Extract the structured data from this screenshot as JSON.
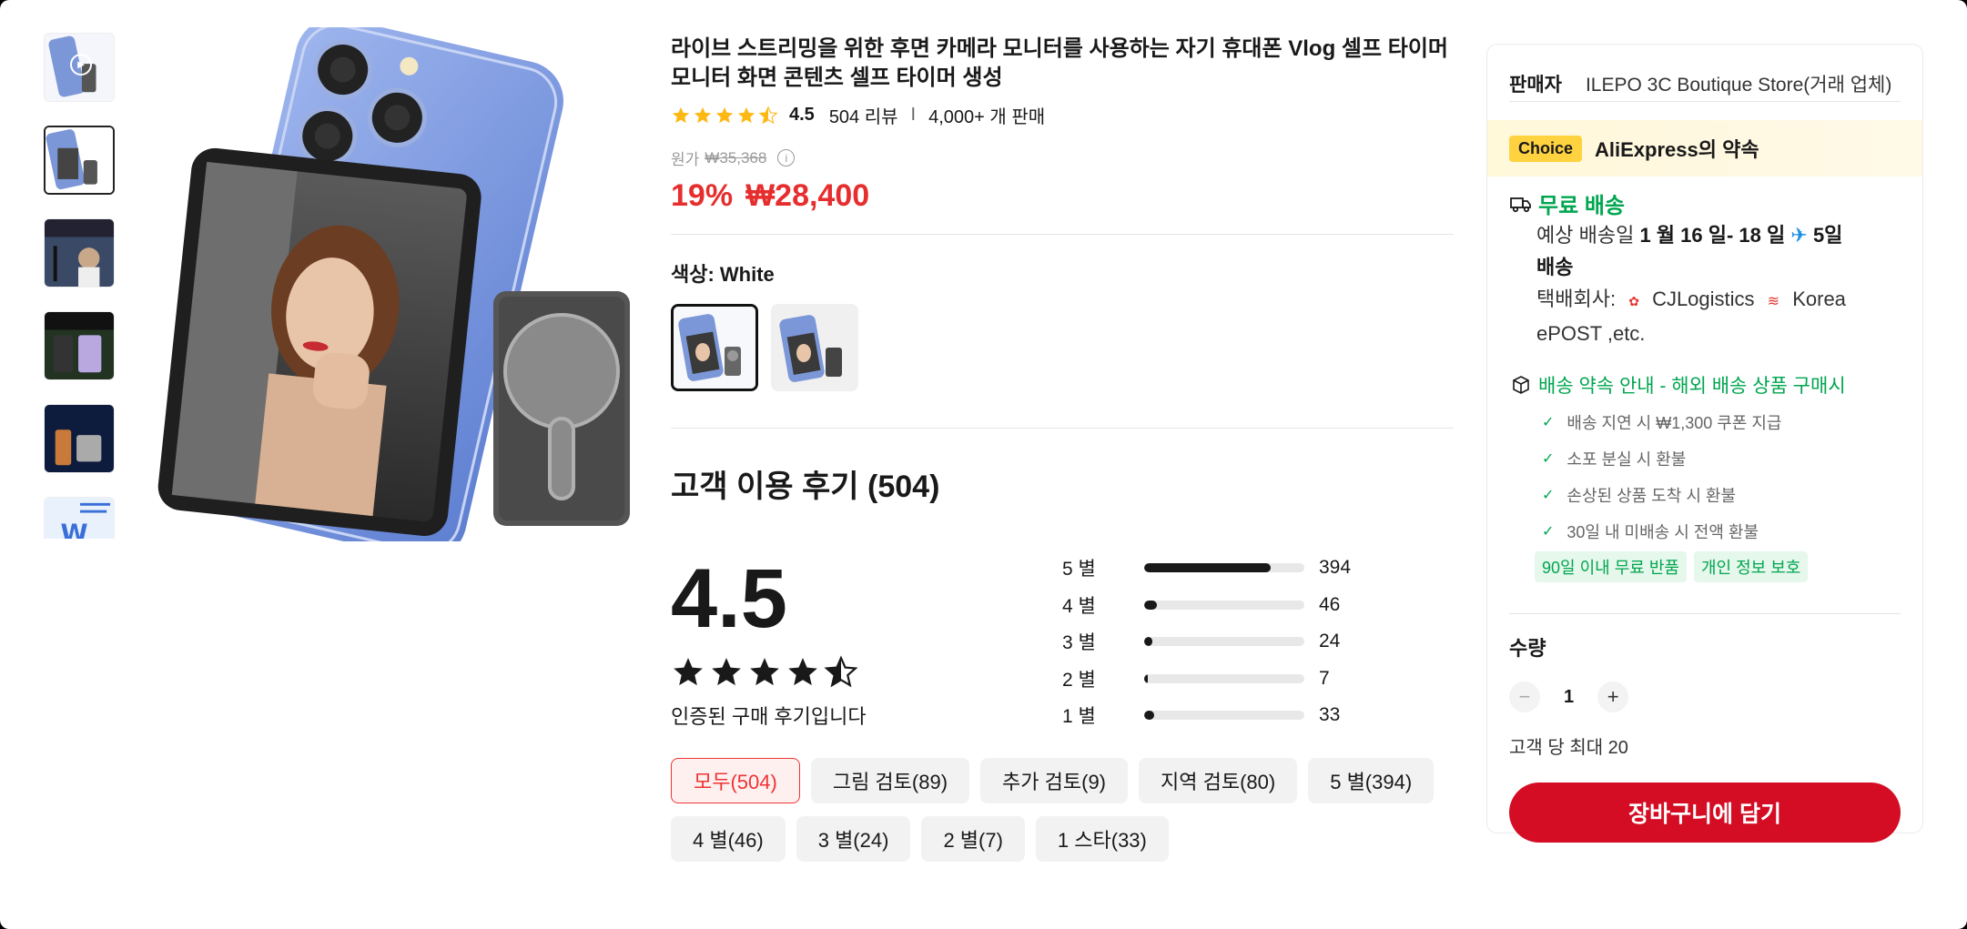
{
  "product": {
    "title": "라이브 스트리밍을 위한 후면 카메라 모니터를 사용하는 자기 휴대폰 Vlog 셀프 타이머 모니터 화면 콘텐츠 셀프 타이머 생성",
    "rating": "4.5",
    "review_count": "504 리뷰",
    "separator": "I",
    "sold": "4,000+ 개 판매",
    "original_price_label": "원가",
    "original_price": "₩35,368",
    "discount": "19%",
    "price": "₩28,400",
    "color_label": "색상: White"
  },
  "reviews": {
    "title": "고객 이용 후기 (504)",
    "average": "4.5",
    "verified": "인증된 구매 후기입니다",
    "breakdown": [
      {
        "label": "5 별",
        "count": "394",
        "fraction": 0.79
      },
      {
        "label": "4 별",
        "count": "46",
        "fraction": 0.08
      },
      {
        "label": "3 별",
        "count": "24",
        "fraction": 0.05
      },
      {
        "label": "2 별",
        "count": "7",
        "fraction": 0.02
      },
      {
        "label": "1 별",
        "count": "33",
        "fraction": 0.06
      }
    ],
    "filters": [
      "모두(504)",
      "그림 검토(89)",
      "추가 검토(9)",
      "지역 검토(80)",
      "5 별(394)",
      "4 별(46)",
      "3 별(24)",
      "2 별(7)",
      "1 스타(33)"
    ]
  },
  "seller": {
    "label": "판매자",
    "name": "ILEPO 3C Boutique Store(거래 업체)"
  },
  "promise": {
    "badge": "Choice",
    "title": "AliExpress의 약속"
  },
  "shipping": {
    "free": "무료 배송",
    "est_prefix": "예상 배송일",
    "est_dates": "1 월 16 일- 18 일",
    "est_days": "5일",
    "est_suffix": "배송",
    "carrier_label": "택배회사:",
    "carrier1": "CJLogistics",
    "carrier2": "Korea",
    "carrier3": "ePOST ,etc."
  },
  "policy": {
    "title": "배송 약속 안내 - 해외 배송 상품 구매시",
    "items": [
      "배송 지연 시 ₩1,300 쿠폰 지급",
      "소포 분실 시 환불",
      "손상된 상품 도착 시 환불",
      "30일 내 미배송 시 전액 환불"
    ],
    "tags": [
      "90일 이내 무료 반품",
      "개인 정보 보호"
    ]
  },
  "quantity": {
    "label": "수량",
    "minus": "−",
    "value": "1",
    "plus": "+",
    "max": "고객 당 최대 20"
  },
  "cart_button": "장바구니에 담기",
  "colors": {
    "price_red": "#e62e2e",
    "green": "#00a64f",
    "cart_red": "#d40d25",
    "choice_yellow": "#ffd23f"
  }
}
